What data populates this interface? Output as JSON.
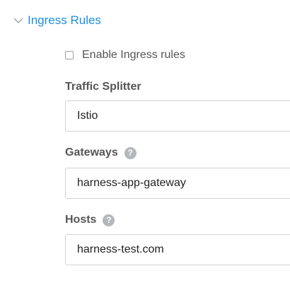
{
  "section": {
    "title": "Ingress Rules",
    "expanded": true,
    "accent_color": "#1d8fe0"
  },
  "enable_ingress": {
    "label": "Enable Ingress rules",
    "checked": false
  },
  "traffic_splitter": {
    "label": "Traffic Splitter",
    "value": "Istio"
  },
  "gateways": {
    "label": "Gateways",
    "help_icon": "?",
    "value": "harness-app-gateway"
  },
  "hosts": {
    "label": "Hosts",
    "help_icon": "?",
    "value": "harness-test.com"
  }
}
